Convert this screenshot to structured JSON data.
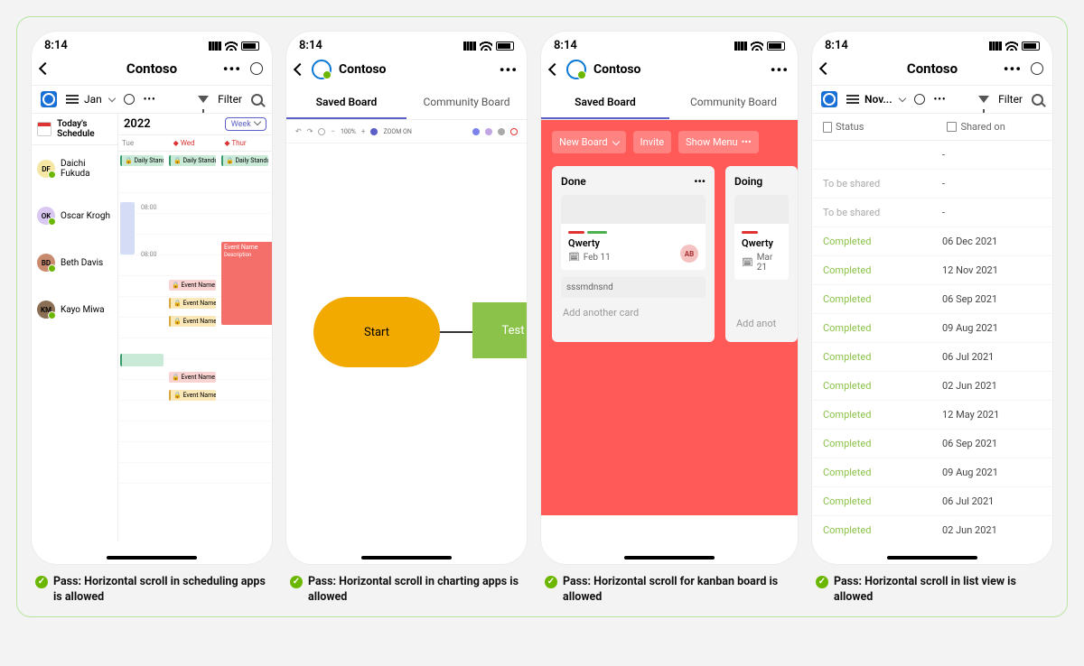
{
  "status_time": "8:14",
  "app_title": "Contoso",
  "more_dots": "•••",
  "toolbar": {
    "jan": "Jan",
    "nov": "Nov...",
    "filter": "Filter"
  },
  "tabs": {
    "saved": "Saved Board",
    "community": "Community Board"
  },
  "phone1": {
    "today": "Today's Schedule",
    "year": "2022",
    "week": "Week",
    "days": [
      "Tue",
      "Wed",
      "Thur"
    ],
    "people": [
      {
        "initials": "DF",
        "name": "Daichi Fukuda",
        "color": "#f5e6a3"
      },
      {
        "initials": "OK",
        "name": "Oscar Krogh",
        "color": "#d9c9f2"
      },
      {
        "initials": "BD",
        "name": "Beth Davis",
        "color": "#c98b6f"
      },
      {
        "initials": "KM",
        "name": "Kayo Miwa",
        "color": "#8b6f55"
      }
    ],
    "events": {
      "standup": "Daily Standup",
      "event": "Event Name",
      "desc": "Description",
      "time": "08:00"
    }
  },
  "phone2": {
    "zoom_pct": "100%",
    "zoom_on": "ZOOM ON",
    "start": "Start",
    "test": "Test"
  },
  "phone3": {
    "new_board": "New Board",
    "invite": "Invite",
    "show_menu": "Show Menu",
    "cols": [
      {
        "title": "Done",
        "card_title": "Qwerty",
        "date": "Feb 11",
        "input": "sssmdnsnd",
        "avatar": "AB"
      },
      {
        "title": "Doing",
        "card_title": "Qwerty",
        "date": "Mar 21"
      }
    ],
    "add_card": "Add another card",
    "add_short": "Add anot"
  },
  "phone4": {
    "col_status": "Status",
    "col_shared": "Shared on",
    "rows": [
      {
        "status": "",
        "date": "-",
        "cls": ""
      },
      {
        "status": "To be shared",
        "date": "-",
        "cls": "st-tbs"
      },
      {
        "status": "To be shared",
        "date": "-",
        "cls": "st-tbs"
      },
      {
        "status": "Completed",
        "date": "06 Dec 2021",
        "cls": "st-completed"
      },
      {
        "status": "Completed",
        "date": "12 Nov 2021",
        "cls": "st-completed"
      },
      {
        "status": "Completed",
        "date": "06 Sep 2021",
        "cls": "st-completed"
      },
      {
        "status": "Completed",
        "date": "09 Aug 2021",
        "cls": "st-completed"
      },
      {
        "status": "Completed",
        "date": "06 Jul 2021",
        "cls": "st-completed"
      },
      {
        "status": "Completed",
        "date": "02 Jun 2021",
        "cls": "st-completed"
      },
      {
        "status": "Completed",
        "date": "12 May 2021",
        "cls": "st-completed"
      },
      {
        "status": "Completed",
        "date": "06 Sep 2021",
        "cls": "st-completed"
      },
      {
        "status": "Completed",
        "date": "09 Aug 2021",
        "cls": "st-completed"
      },
      {
        "status": "Completed",
        "date": "06 Jul 2021",
        "cls": "st-completed"
      },
      {
        "status": "Completed",
        "date": "02 Jun 2021",
        "cls": "st-completed"
      }
    ]
  },
  "captions": [
    "Pass: Horizontal scroll in scheduling apps is allowed",
    "Pass: Horizontal scroll in charting apps is allowed",
    "Pass: Horizontal scroll for kanban board is allowed",
    "Pass: Horizontal scroll in list view is allowed"
  ]
}
